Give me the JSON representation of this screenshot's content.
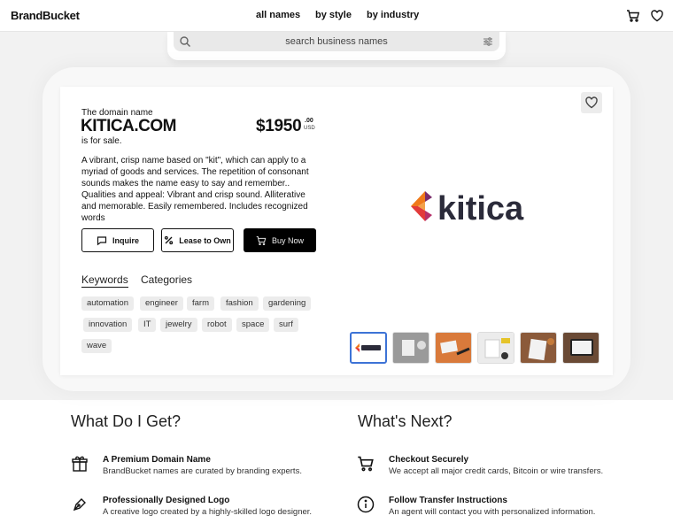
{
  "header": {
    "logo": "BrandBucket",
    "nav": [
      "all names",
      "by style",
      "by industry"
    ],
    "icons": [
      "cart-icon",
      "heart-icon"
    ]
  },
  "search": {
    "placeholder": "search business names",
    "icons": [
      "search-icon",
      "filter-icon"
    ]
  },
  "listing": {
    "intro": "The domain name",
    "domain": "KITICA.COM",
    "for_sale": "is for sale.",
    "price": "$1950",
    "price_cents": ".00",
    "currency": "USD",
    "description": "A vibrant, crisp name based on \"kit\", which can apply to a myriad of goods and services. The repetition of consonant sounds makes the name easy to say and remember.. Qualities and appeal: Vibrant and crisp sound. Alliterative and memorable. Easily remembered. Includes recognized words",
    "buttons": {
      "inquire": "Inquire",
      "lease": "Lease to Own",
      "buy": "Buy Now"
    },
    "tabs": [
      "Keywords",
      "Categories"
    ],
    "keywords": [
      "automation",
      "engineer",
      "farm",
      "fashion",
      "gardening",
      "innovation",
      "IT",
      "jewelry",
      "robot",
      "space",
      "surf",
      "wave"
    ],
    "logo_text": "kitica",
    "logo_colors": [
      "#e23a3a",
      "#f07a1a",
      "#7a2c6b",
      "#2b2b3a"
    ],
    "thumbnail_count": 6
  },
  "bottom": {
    "left_heading": "What Do I Get?",
    "right_heading": "What's Next?",
    "left_items": [
      {
        "icon": "gift-icon",
        "title": "A Premium Domain Name",
        "text": "BrandBucket names are curated by branding experts."
      },
      {
        "icon": "pen-icon",
        "title": "Professionally Designed Logo",
        "text": "A creative logo created by a highly-skilled logo designer."
      }
    ],
    "right_items": [
      {
        "icon": "cart-icon",
        "title": "Checkout Securely",
        "text": "We accept all major credit cards, Bitcoin or wire transfers."
      },
      {
        "icon": "info-icon",
        "title": "Follow Transfer Instructions",
        "text": "An agent will contact you with personalized information."
      }
    ]
  }
}
